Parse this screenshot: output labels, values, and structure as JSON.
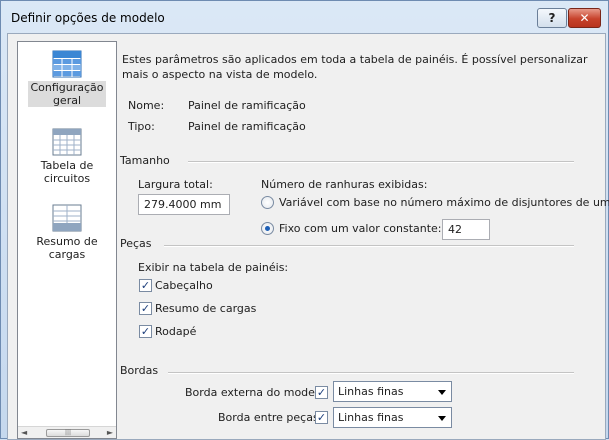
{
  "window": {
    "title": "Definir opções de modelo",
    "help_label": "?",
    "close_label": "✕"
  },
  "nav": {
    "items": [
      {
        "label_line1": "Configuração",
        "label_line2": "geral",
        "icon": "general-settings-icon",
        "selected": true
      },
      {
        "label_line1": "Tabela de",
        "label_line2": "circuitos",
        "icon": "circuit-table-icon",
        "selected": false
      },
      {
        "label_line1": "Resumo de",
        "label_line2": "cargas",
        "icon": "load-summary-icon",
        "selected": false
      }
    ],
    "scroll_left": "◄",
    "scroll_right": "►",
    "scroll_grip": "|||"
  },
  "intro": "Estes parâmetros são aplicados em toda a tabela de  painéis. É possível personalizar mais o aspecto na vista de modelo.",
  "info": {
    "name_label": "Nome:",
    "name_value": "Painel de ramificação",
    "type_label": "Tipo:",
    "type_value": "Painel de ramificação"
  },
  "size": {
    "header": "Tamanho",
    "width_label": "Largura total:",
    "width_value": "279.4000 mm",
    "slots_label": "Número de ranhuras exibidas:",
    "option_variable": "Variável com base no número máximo de disjuntores de um pólo",
    "option_fixed": "Fixo com um valor constante:",
    "fixed_value": "42",
    "selected_option": "fixed"
  },
  "parts": {
    "header": "Peças",
    "show_label": "Exibir na tabela de painéis:",
    "header_check": "Cabeçalho",
    "loads_check": "Resumo de cargas",
    "footer_check": "Rodapé"
  },
  "borders": {
    "header": "Bordas",
    "outer_label": "Borda externa do modelo:",
    "outer_value": "Linhas finas",
    "between_label": "Borda entre peças:",
    "between_value": "Linhas finas"
  },
  "colors": {
    "selection_gray": "#dcdcdc",
    "close_red": "#c7422b",
    "title_blue": "#dbe8f6"
  }
}
